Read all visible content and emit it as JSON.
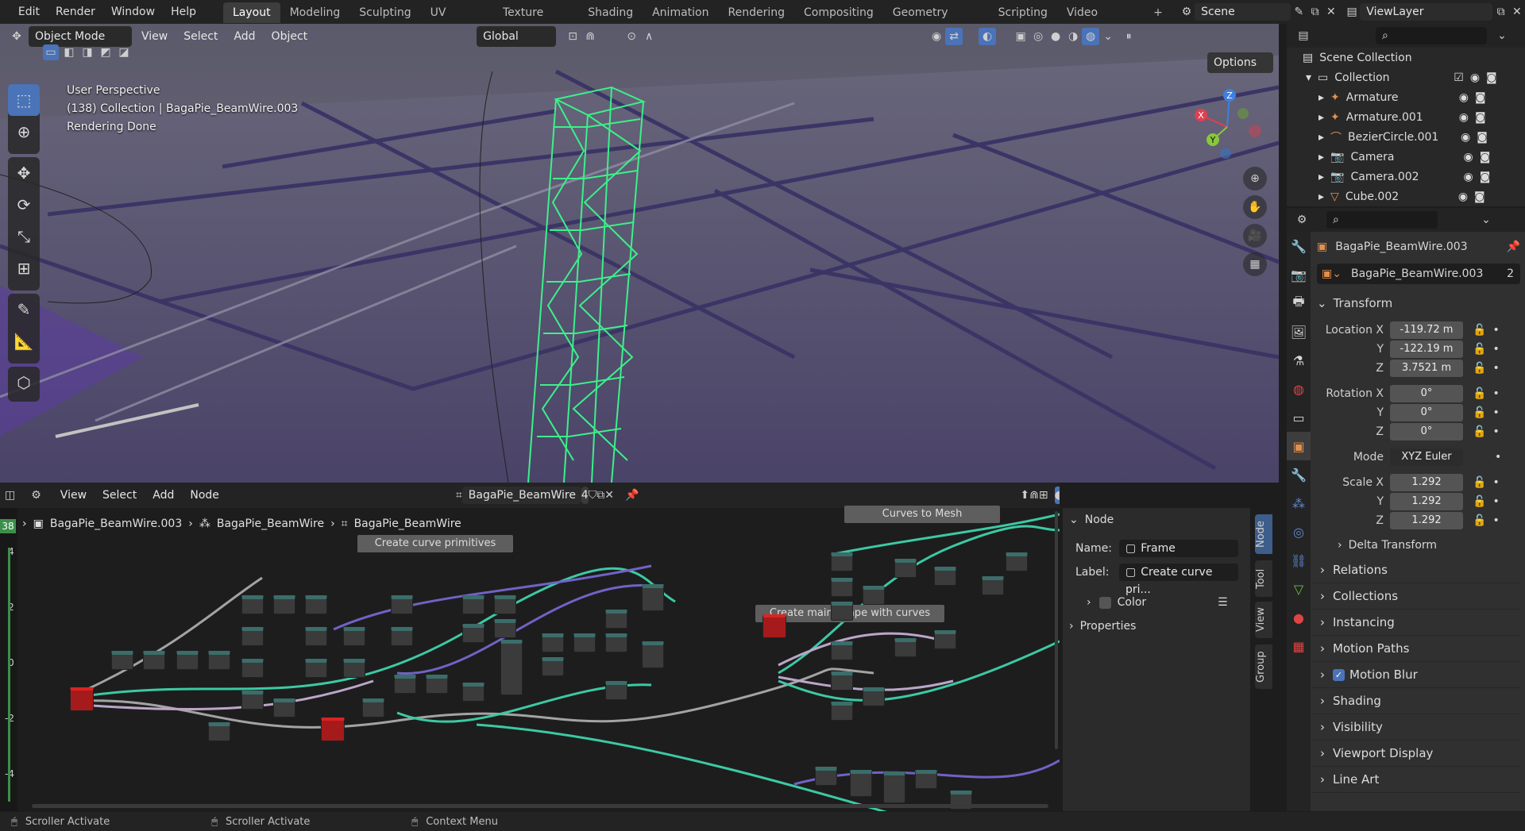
{
  "topbar": {
    "menus": [
      "Edit",
      "Render",
      "Window",
      "Help"
    ],
    "workspaces": [
      "Layout",
      "Modeling",
      "Sculpting",
      "UV Editing",
      "Texture Paint",
      "Shading",
      "Animation",
      "Rendering",
      "Compositing",
      "Geometry Nodes",
      "Scripting",
      "Video Editing"
    ],
    "active_workspace": "Layout",
    "add_tab": "+",
    "scene": "Scene",
    "view_layer": "ViewLayer"
  },
  "viewport": {
    "mode": "Object Mode",
    "menus": [
      "View",
      "Select",
      "Add",
      "Object"
    ],
    "transform_orientation": "Global",
    "options": "Options",
    "overlay_lines": [
      "User Perspective",
      "(138) Collection | BagaPie_BeamWire.003",
      "Rendering Done"
    ],
    "gizmo": {
      "x": "X",
      "y": "Y",
      "z": "Z"
    },
    "colors": {
      "wire": "#3cf08a",
      "sky": "#5b5a6b",
      "ground": "#3e3560"
    }
  },
  "node_editor": {
    "menus": [
      "View",
      "Select",
      "Add",
      "Node"
    ],
    "node_tree": "BagaPie_BeamWire",
    "users": "4",
    "breadcrumb": [
      "BagaPie_BeamWire.003",
      "BagaPie_BeamWire",
      "BagaPie_BeamWire"
    ],
    "frame_labels": [
      "Create curve primitives",
      "Curves to Mesh",
      "Create main shape with curves"
    ],
    "ruler": {
      "frame": "38",
      "ticks": [
        "4",
        "2",
        "0",
        "-2",
        "-4"
      ]
    },
    "side_tabs": [
      "Node",
      "Tool",
      "View",
      "Group"
    ],
    "colors": {
      "geometry_link": "#3cc9a4",
      "float_link": "#a3a3a3",
      "vector_link": "#6f63c6",
      "group_node": "#a51a1a"
    }
  },
  "node_panel": {
    "header": "Node",
    "name_label": "Name:",
    "name_value": "Frame",
    "label_label": "Label:",
    "label_value": "Create curve pri...",
    "color_label": "Color",
    "properties": "Properties"
  },
  "outliner": {
    "root": "Scene Collection",
    "collection": "Collection",
    "items": [
      "Armature",
      "Armature.001",
      "BezierCircle.001",
      "Camera",
      "Camera.002",
      "Cube.002"
    ]
  },
  "properties": {
    "object_name": "BagaPie_BeamWire.003",
    "data_name": "BagaPie_BeamWire.003",
    "data_users": "2",
    "transform_header": "Transform",
    "location": {
      "label": "Location X",
      "y_label": "Y",
      "z_label": "Z",
      "x": "-119.72 m",
      "y": "-122.19 m",
      "z": "3.7521 m"
    },
    "rotation": {
      "label": "Rotation X",
      "y_label": "Y",
      "z_label": "Z",
      "x": "0°",
      "y": "0°",
      "z": "0°"
    },
    "mode_label": "Mode",
    "mode_value": "XYZ Euler",
    "scale": {
      "label": "Scale X",
      "y_label": "Y",
      "z_label": "Z",
      "x": "1.292",
      "y": "1.292",
      "z": "1.292"
    },
    "delta": "Delta Transform",
    "sections": [
      "Relations",
      "Collections",
      "Instancing",
      "Motion Paths",
      "Motion Blur",
      "Shading",
      "Visibility",
      "Viewport Display",
      "Line Art"
    ]
  },
  "statusbar": {
    "left": "Scroller Activate",
    "middle": "Scroller Activate",
    "right": "Context Menu"
  }
}
